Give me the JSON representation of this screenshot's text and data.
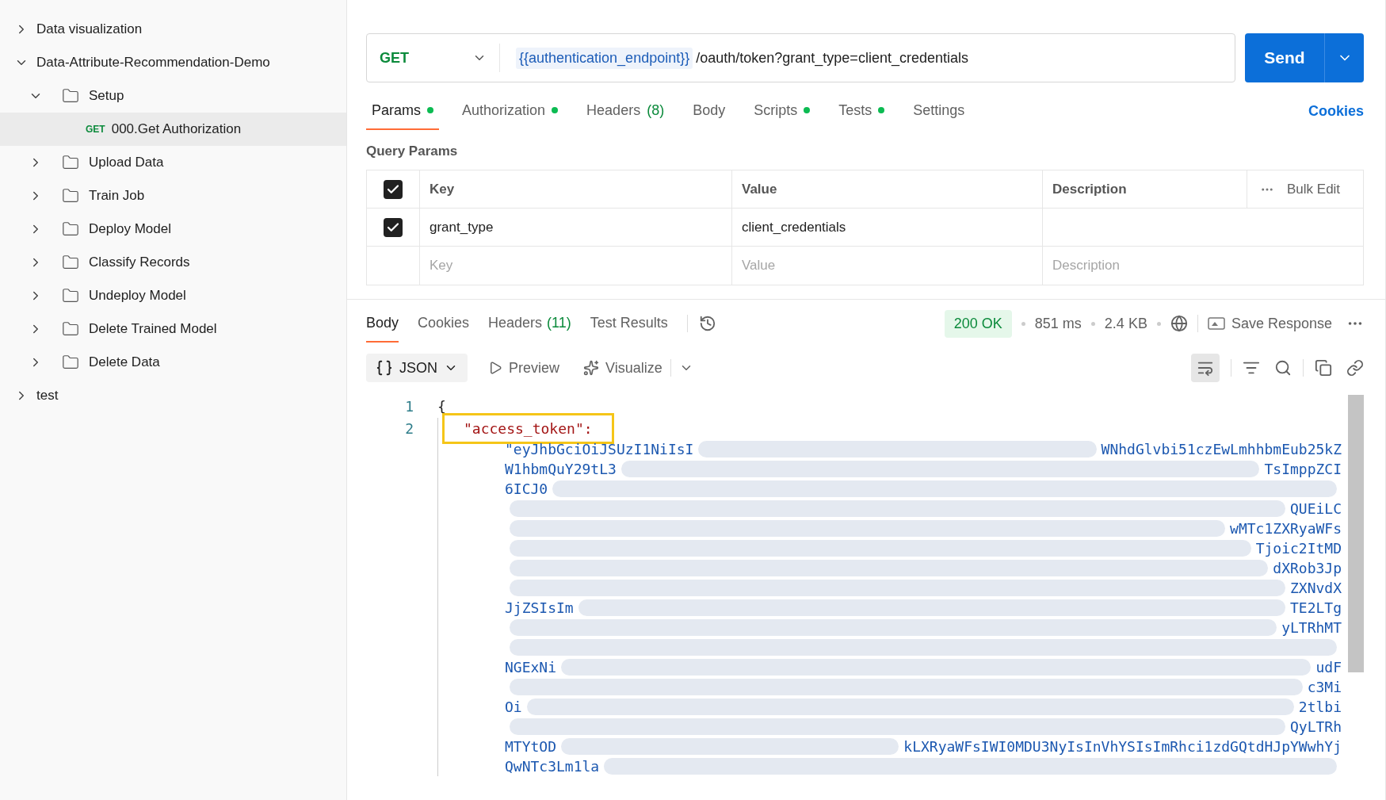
{
  "sidebar": {
    "items": [
      {
        "kind": "collection",
        "label": "Data visualization",
        "expanded": false
      },
      {
        "kind": "collection",
        "label": "Data-Attribute-Recommendation-Demo",
        "expanded": true,
        "children": [
          {
            "kind": "folder",
            "label": "Setup",
            "expanded": true,
            "children": [
              {
                "kind": "request",
                "method": "GET",
                "label": "000.Get Authorization",
                "selected": true
              }
            ]
          },
          {
            "kind": "folder",
            "label": "Upload Data",
            "expanded": false
          },
          {
            "kind": "folder",
            "label": "Train Job",
            "expanded": false
          },
          {
            "kind": "folder",
            "label": "Deploy Model",
            "expanded": false
          },
          {
            "kind": "folder",
            "label": "Classify Records",
            "expanded": false
          },
          {
            "kind": "folder",
            "label": "Undeploy Model",
            "expanded": false
          },
          {
            "kind": "folder",
            "label": "Delete Trained Model",
            "expanded": false
          },
          {
            "kind": "folder",
            "label": "Delete Data",
            "expanded": false
          }
        ]
      },
      {
        "kind": "collection",
        "label": "test",
        "expanded": false
      }
    ]
  },
  "request": {
    "method": "GET",
    "url_variable": "{{authentication_endpoint}}",
    "url_path": "/oauth/token?grant_type=client_credentials",
    "send": "Send"
  },
  "request_tabs": [
    {
      "label": "Params",
      "dot": true,
      "selected": true
    },
    {
      "label": "Authorization",
      "dot": true,
      "selected": false
    },
    {
      "label": "Headers",
      "count": "(8)",
      "dot": false,
      "selected": false
    },
    {
      "label": "Body",
      "dot": false,
      "selected": false
    },
    {
      "label": "Scripts",
      "dot": true,
      "selected": false
    },
    {
      "label": "Tests",
      "dot": true,
      "selected": false
    },
    {
      "label": "Settings",
      "dot": false,
      "selected": false
    }
  ],
  "cookies_link": "Cookies",
  "query_params": {
    "title": "Query Params",
    "header_checked": true,
    "columns": [
      "Key",
      "Value",
      "Description"
    ],
    "bulk_edit": "Bulk Edit",
    "rows": [
      {
        "checked": true,
        "key": "grant_type",
        "value": "client_credentials"
      }
    ],
    "new_row": {
      "key": "Key",
      "value": "Value",
      "description": "Description"
    }
  },
  "response": {
    "tabs": [
      {
        "label": "Body",
        "selected": true
      },
      {
        "label": "Cookies",
        "selected": false
      },
      {
        "label": "Headers",
        "count": "(11)",
        "selected": false
      },
      {
        "label": "Test Results",
        "selected": false
      }
    ],
    "status": "200 OK",
    "time": "851 ms",
    "size": "2.4 KB",
    "save": "Save Response",
    "format": "JSON",
    "preview": "Preview",
    "visualize": "Visualize",
    "wrap_on": true
  },
  "code": {
    "lines": [
      {
        "number": "1",
        "text": "{",
        "highlighted": false
      },
      {
        "number": "2",
        "text": "\"access_token\":",
        "highlighted": true
      }
    ],
    "token_rows": [
      {
        "left": "\"eyJhbGciOiJSUzI1NiIsI",
        "right": "WNhdGlvbi51czEwLmhhbmEub25kZ"
      },
      {
        "left": "W1hbmQuY29tL3",
        "right": "TsImppZCI"
      },
      {
        "left": "6ICJ0",
        "right": ""
      },
      {
        "left": "",
        "right": "QUEiLC"
      },
      {
        "left": "",
        "right": "wMTc1ZXRyaWFs"
      },
      {
        "left": "",
        "right": "Tjoic2ItMD"
      },
      {
        "left": "",
        "right": "dXRob3Jp"
      },
      {
        "left": "",
        "right": "ZXNvdX"
      },
      {
        "left": "JjZSIsIm",
        "right": "TE2LTg"
      },
      {
        "left": "",
        "right": "yLTRhMT"
      },
      {
        "left": "",
        "right": ""
      },
      {
        "left": "NGExNi",
        "right": "udF"
      },
      {
        "left": "",
        "right": "c3Mi"
      },
      {
        "left": "Oi",
        "right": "2tlbi"
      },
      {
        "left": "",
        "right": "QyLTRh"
      },
      {
        "left": "MTYtOD",
        "right": "kLXRyaWFsIWI0MDU3NyIsInVhYSIsImRhci1zdGQtdHJpYWwhYj"
      },
      {
        "left": "QwNTc3Lm1la",
        "right": ""
      }
    ]
  }
}
